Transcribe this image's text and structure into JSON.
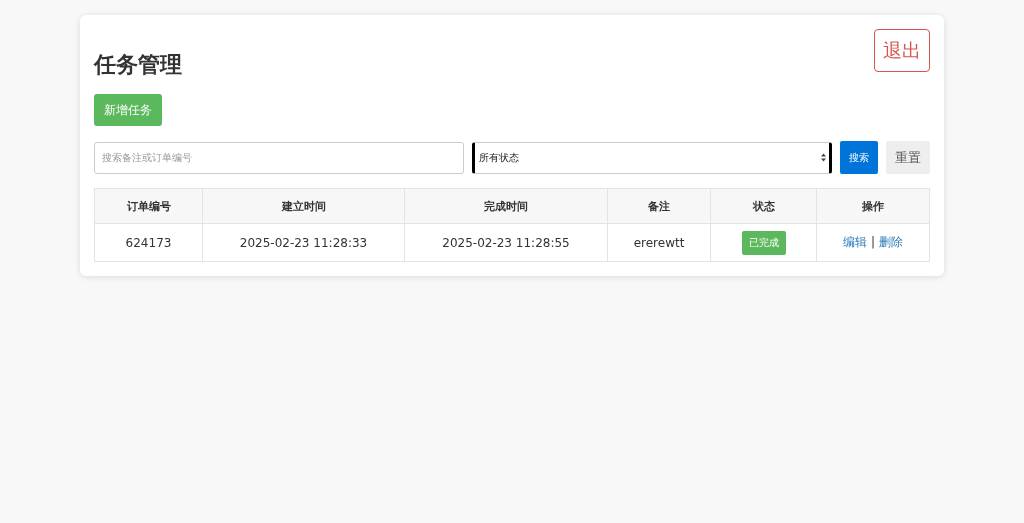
{
  "title": "任务管理",
  "logout_button": "退出",
  "add_button": "新增任务",
  "search": {
    "placeholder": "搜索备注或订单编号"
  },
  "status_filter": {
    "value": "所有状态"
  },
  "search_button": "搜索",
  "reset_button": "重置",
  "table": {
    "columns": [
      "订单编号",
      "建立时间",
      "完成时间",
      "备注",
      "状态",
      "操作"
    ],
    "rows": [
      {
        "order_no": "624173",
        "created": "2025-02-23 11:28:33",
        "completed": "2025-02-23 11:28:55",
        "note": "ererewtt",
        "status": {
          "label": "已完成",
          "color": "#5cb85c"
        },
        "actions": {
          "edit": "编辑",
          "separator": "|",
          "delete": "删除"
        }
      }
    ]
  }
}
